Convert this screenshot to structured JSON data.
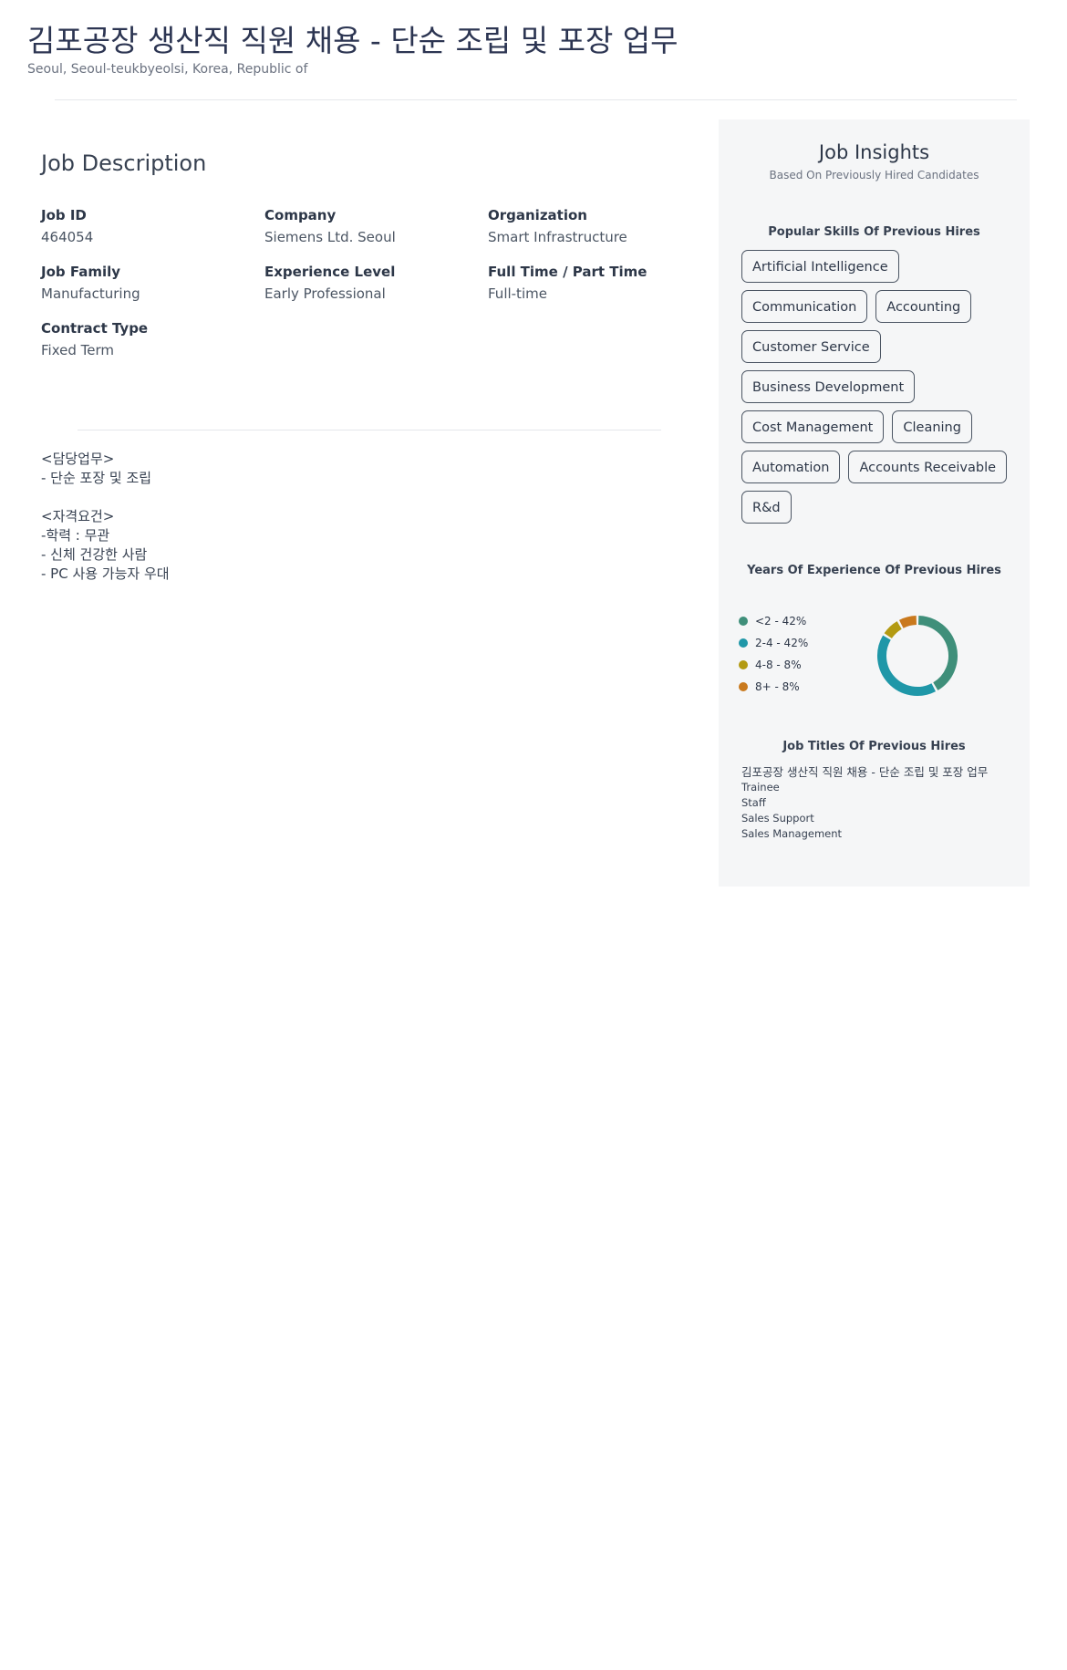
{
  "header": {
    "title": "김포공장 생산직 직원 채용 - 단순 조립 및 포장 업무",
    "location": "Seoul, Seoul-teukbyeolsi, Korea, Republic of"
  },
  "job": {
    "section_title": "Job Description",
    "fields": [
      {
        "label": "Job ID",
        "value": "464054"
      },
      {
        "label": "Company",
        "value": "Siemens Ltd. Seoul"
      },
      {
        "label": "Organization",
        "value": "Smart Infrastructure"
      },
      {
        "label": "Job Family",
        "value": "Manufacturing"
      },
      {
        "label": "Experience Level",
        "value": "Early Professional"
      },
      {
        "label": "Full Time / Part Time",
        "value": "Full-time"
      },
      {
        "label": "Contract Type",
        "value": "Fixed Term"
      }
    ],
    "description": [
      "<담당업무>",
      "- 단순 포장 및 조립",
      "",
      "<자격요건>",
      "-학력 : 무관",
      "- 신체 건강한 사람",
      "- PC 사용 가능자 우대"
    ]
  },
  "insights": {
    "title": "Job Insights",
    "subtitle": "Based On Previously Hired Candidates",
    "skills_title": "Popular Skills Of Previous Hires",
    "skills": [
      "Artificial Intelligence",
      "Communication",
      "Accounting",
      "Customer Service",
      "Business Development",
      "Cost Management",
      "Cleaning",
      "Automation",
      "Accounts Receivable",
      "R&d"
    ],
    "experience_title": "Years Of Experience Of Previous Hires",
    "experience": [
      {
        "label": "<2 - 42%",
        "value": 42,
        "color": "#3f8f7a"
      },
      {
        "label": "2-4 - 42%",
        "value": 42,
        "color": "#1f97a8"
      },
      {
        "label": "4-8 - 8%",
        "value": 8,
        "color": "#b39a12"
      },
      {
        "label": "8+ - 8%",
        "value": 8,
        "color": "#c9791d"
      }
    ],
    "job_titles_title": "Job Titles Of Previous Hires",
    "job_titles": [
      "김포공장 생산직 직원 채용 - 단순 조립 및 포장 업무",
      "Trainee",
      "Staff",
      "Sales Support",
      "Sales Management"
    ]
  }
}
